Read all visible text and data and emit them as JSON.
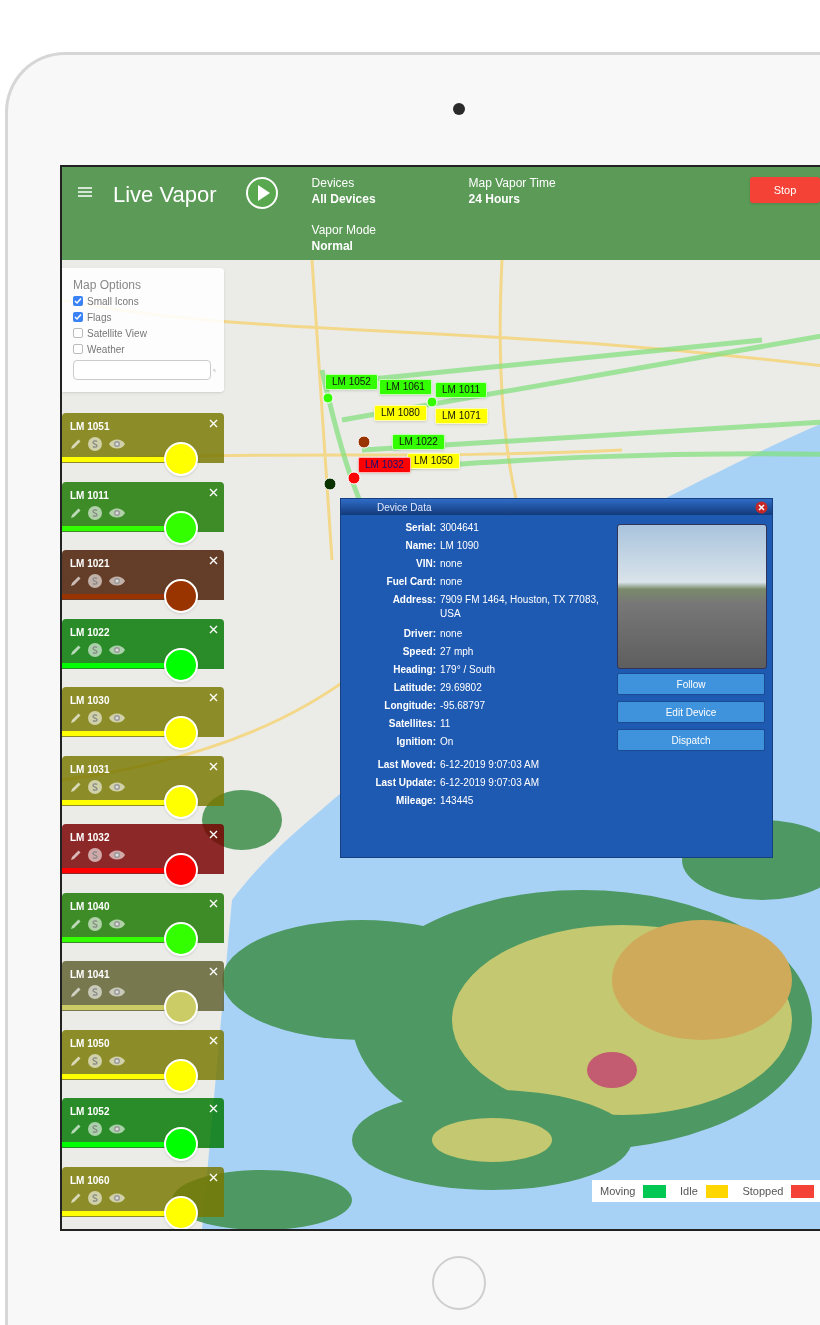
{
  "header": {
    "title": "Live Vapor",
    "devices": {
      "label": "Devices",
      "value": "All Devices"
    },
    "vapor_time": {
      "label": "Map Vapor Time",
      "value": "24 Hours"
    },
    "vapor_mode": {
      "label": "Vapor Mode",
      "value": "Normal"
    },
    "stop_button": "Stop"
  },
  "map_options": {
    "title": "Map Options",
    "options": [
      {
        "label": "Small Icons",
        "checked": true
      },
      {
        "label": "Flags",
        "checked": true
      },
      {
        "label": "Satellite View",
        "checked": false
      },
      {
        "label": "Weather",
        "checked": false
      }
    ]
  },
  "map_flags": [
    {
      "label": "LM 1052",
      "color": "#33ff00"
    },
    {
      "label": "LM 1061",
      "color": "#33ff00"
    },
    {
      "label": "LM 1011",
      "color": "#33ff00"
    },
    {
      "label": "LM 1080",
      "color": "#ffff00"
    },
    {
      "label": "LM 1071",
      "color": "#ffff00"
    },
    {
      "label": "LM 1022",
      "color": "#33ff00"
    },
    {
      "label": "LM 1050",
      "color": "#ffff00"
    },
    {
      "label": "LM 1032",
      "color": "#ff0000"
    }
  ],
  "devices": [
    {
      "name": "LM 1051",
      "color": "#ffff00"
    },
    {
      "name": "LM 1011",
      "color": "#33ff00"
    },
    {
      "name": "LM 1021",
      "color": "#993300"
    },
    {
      "name": "LM 1022",
      "color": "#00ff00"
    },
    {
      "name": "LM 1030",
      "color": "#ffff00"
    },
    {
      "name": "LM 1031",
      "color": "#ffff00"
    },
    {
      "name": "LM 1032",
      "color": "#ff0000"
    },
    {
      "name": "LM 1040",
      "color": "#33ff00"
    },
    {
      "name": "LM 1041",
      "color": "#cccc66"
    },
    {
      "name": "LM 1050",
      "color": "#ffff00"
    },
    {
      "name": "LM 1052",
      "color": "#00ff00"
    },
    {
      "name": "LM 1060",
      "color": "#ffff00"
    }
  ],
  "device_data": {
    "title": "Device Data",
    "fields": [
      {
        "label": "Serial:",
        "value": "3004641"
      },
      {
        "label": "Name:",
        "value": "LM 1090"
      },
      {
        "label": "VIN:",
        "value": "none"
      },
      {
        "label": "Fuel Card:",
        "value": "none"
      },
      {
        "label": "Address:",
        "value": "7909 FM 1464, Houston, TX 77083, USA"
      },
      {
        "label": "Driver:",
        "value": "none"
      },
      {
        "label": "Speed:",
        "value": "27 mph"
      },
      {
        "label": "Heading:",
        "value": "179° / South"
      },
      {
        "label": "Latitude:",
        "value": "29.69802"
      },
      {
        "label": "Longitude:",
        "value": "-95.68797"
      },
      {
        "label": "Satellites:",
        "value": "11"
      },
      {
        "label": "Ignition:",
        "value": "On"
      },
      {
        "label": "Last Moved:",
        "value": "6-12-2019 9:07:03 AM"
      },
      {
        "label": "Last Update:",
        "value": "6-12-2019 9:07:03 AM"
      },
      {
        "label": "Mileage:",
        "value": "143445"
      }
    ],
    "buttons": [
      "Follow",
      "Edit Device",
      "Dispatch"
    ]
  },
  "legend": [
    {
      "label": "Moving",
      "color": "#00c853"
    },
    {
      "label": "Idle",
      "color": "#ffd600"
    },
    {
      "label": "Stopped",
      "color": "#f44336"
    }
  ]
}
